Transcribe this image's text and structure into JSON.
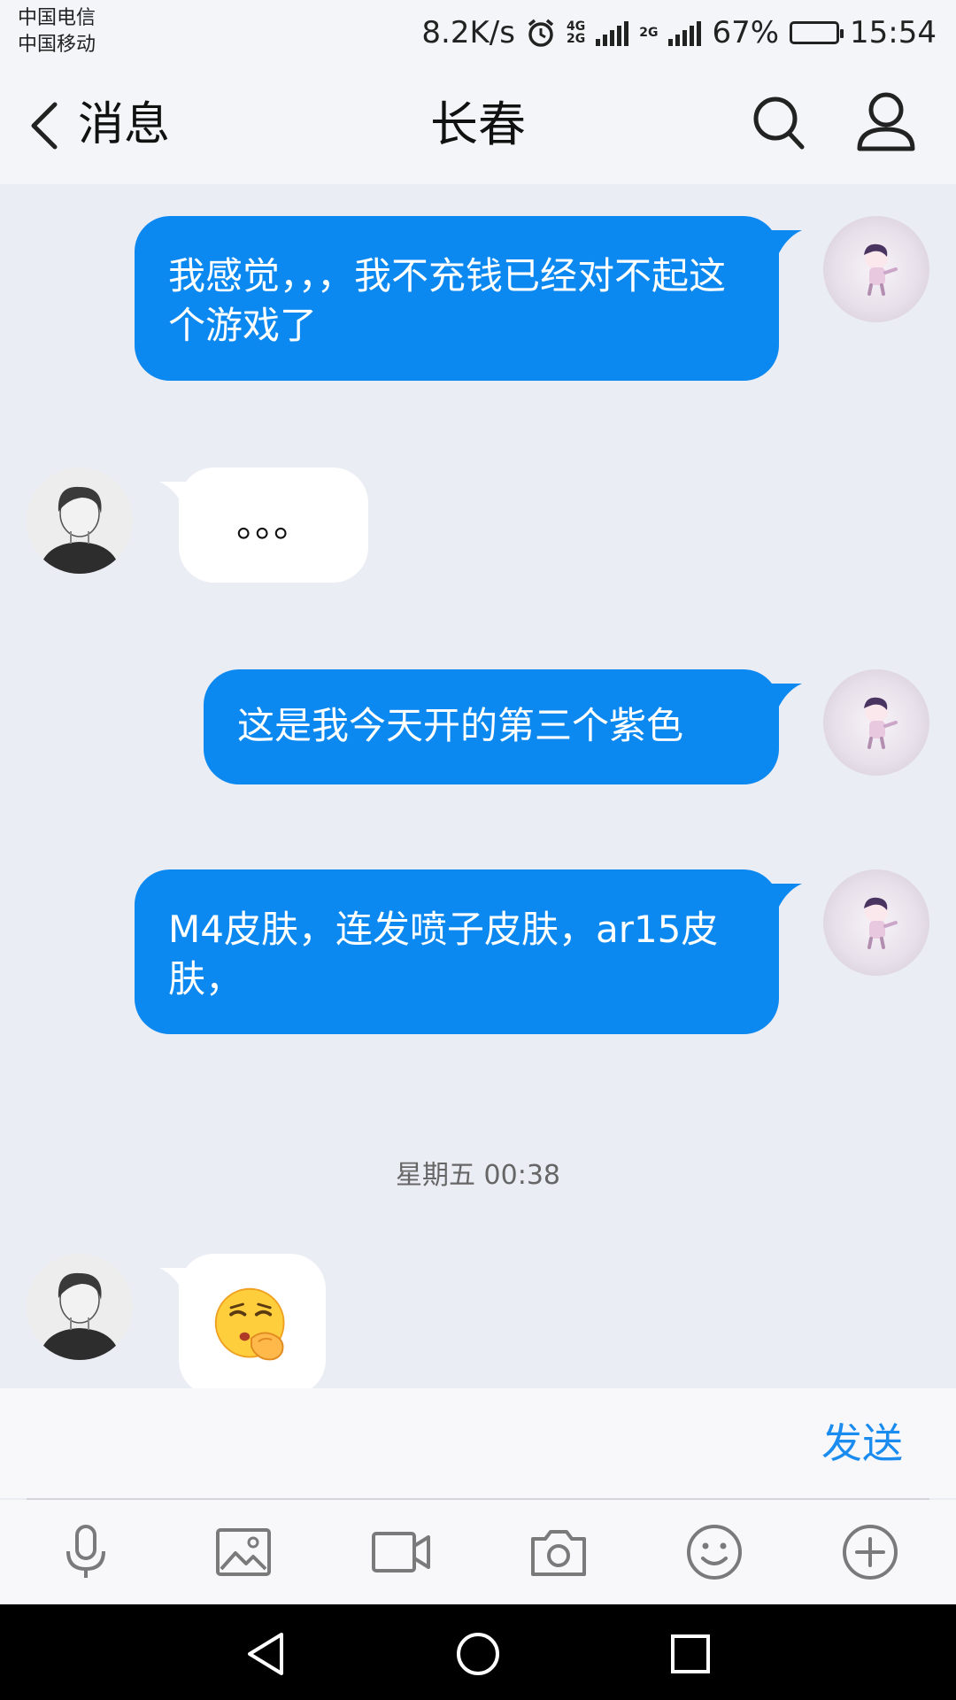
{
  "status_bar": {
    "carrier_1": "中国电信",
    "carrier_2": "中国移动",
    "net_speed": "8.2K/s",
    "net_types_a": "4G",
    "net_types_b": "2G",
    "net_type_c": "2G",
    "battery": "67%",
    "battery_level": 0.67,
    "time": "15:54"
  },
  "header": {
    "back_label": "消息",
    "title": "长春"
  },
  "messages": [
    {
      "sender": "me",
      "text": "我感觉，，，我不充钱已经对不起这个游戏了"
    },
    {
      "sender": "them",
      "text": "。。。"
    },
    {
      "sender": "me",
      "text": "这是我今天开的第三个紫色"
    },
    {
      "sender": "me",
      "text": "M4皮肤，连发喷子皮肤，ar15皮肤，"
    },
    {
      "sender": "them",
      "text": "",
      "emoji": "thinking-face-emoji"
    }
  ],
  "timestamp": "星期五 00:38",
  "input": {
    "send_label": "发送"
  },
  "toolbar_icons": [
    "microphone-icon",
    "image-icon",
    "video-icon",
    "camera-icon",
    "emoji-icon",
    "plus-icon"
  ],
  "nav_icons": [
    "back-triangle-icon",
    "home-circle-icon",
    "recents-square-icon"
  ],
  "colors": {
    "my_bubble": "#0c89f0",
    "their_bubble": "#ffffff",
    "background": "#ebedf5",
    "accent": "#1a8cf0"
  }
}
